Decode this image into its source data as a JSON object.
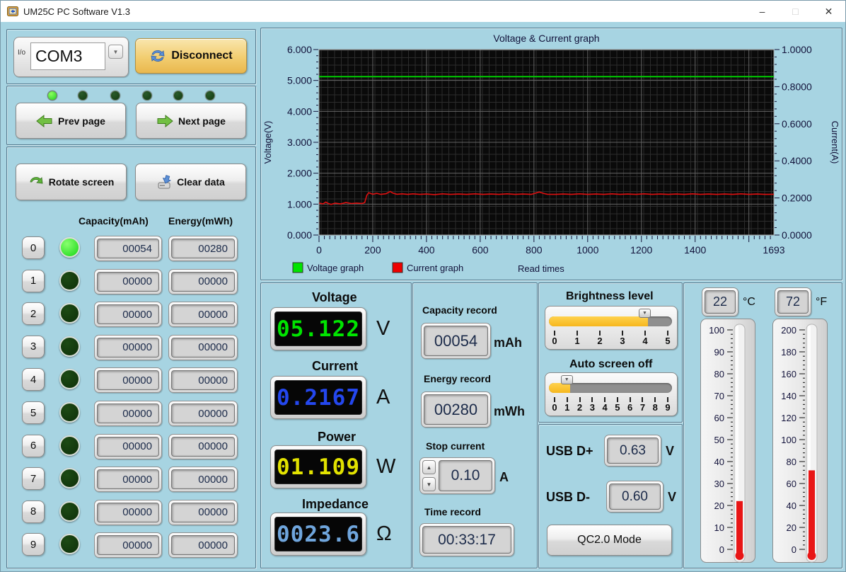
{
  "window": {
    "title": "UM25C PC Software V1.3",
    "minimize": "–",
    "maximize": "□",
    "close": "✕"
  },
  "connection": {
    "port": "COM3",
    "io_icon": "I/o",
    "dropdown_glyph": "▼",
    "disconnect_label": "Disconnect"
  },
  "page_nav": {
    "leds": [
      true,
      false,
      false,
      false,
      false,
      false
    ],
    "prev_label": "Prev page",
    "next_label": "Next page"
  },
  "actions": {
    "rotate_label": "Rotate screen",
    "clear_label": "Clear data"
  },
  "memory_table": {
    "capacity_header": "Capacity(mAh)",
    "energy_header": "Energy(mWh)",
    "rows": [
      {
        "index": "0",
        "active": true,
        "capacity": "00054",
        "energy": "00280"
      },
      {
        "index": "1",
        "active": false,
        "capacity": "00000",
        "energy": "00000"
      },
      {
        "index": "2",
        "active": false,
        "capacity": "00000",
        "energy": "00000"
      },
      {
        "index": "3",
        "active": false,
        "capacity": "00000",
        "energy": "00000"
      },
      {
        "index": "4",
        "active": false,
        "capacity": "00000",
        "energy": "00000"
      },
      {
        "index": "5",
        "active": false,
        "capacity": "00000",
        "energy": "00000"
      },
      {
        "index": "6",
        "active": false,
        "capacity": "00000",
        "energy": "00000"
      },
      {
        "index": "7",
        "active": false,
        "capacity": "00000",
        "energy": "00000"
      },
      {
        "index": "8",
        "active": false,
        "capacity": "00000",
        "energy": "00000"
      },
      {
        "index": "9",
        "active": false,
        "capacity": "00000",
        "energy": "00000"
      }
    ]
  },
  "chart_data": {
    "type": "line",
    "title": "Voltage & Current graph",
    "xlabel": "Read times",
    "ylabel_left": "Voltage(V)",
    "ylabel_right": "Current(A)",
    "xlim": [
      0,
      1693
    ],
    "x_ticks": [
      0,
      200,
      400,
      600,
      800,
      1000,
      1200,
      1400,
      1693
    ],
    "ylim_left": [
      0,
      6
    ],
    "y_ticks_left": [
      "6.000",
      "5.000",
      "4.000",
      "3.000",
      "2.000",
      "1.000",
      "0.000"
    ],
    "ylim_right": [
      0,
      1
    ],
    "y_ticks_right": [
      "1.0000",
      "0.8000",
      "0.6000",
      "0.4000",
      "0.2000",
      "0.0000"
    ],
    "legend": [
      {
        "label": "Voltage graph",
        "color": "#00e400"
      },
      {
        "label": "Current graph",
        "color": "#ee0000"
      }
    ],
    "series": [
      {
        "name": "Voltage",
        "axis": "left",
        "color": "#00cc00",
        "points": [
          [
            0,
            5.122
          ],
          [
            1693,
            5.122
          ]
        ]
      },
      {
        "name": "Current",
        "axis": "right",
        "color": "#e01010",
        "points": [
          [
            0,
            0.172
          ],
          [
            15,
            0.168
          ],
          [
            25,
            0.178
          ],
          [
            35,
            0.17
          ],
          [
            45,
            0.165
          ],
          [
            60,
            0.172
          ],
          [
            80,
            0.168
          ],
          [
            100,
            0.175
          ],
          [
            120,
            0.17
          ],
          [
            140,
            0.172
          ],
          [
            160,
            0.17
          ],
          [
            170,
            0.175
          ],
          [
            178,
            0.215
          ],
          [
            185,
            0.228
          ],
          [
            200,
            0.22
          ],
          [
            215,
            0.225
          ],
          [
            230,
            0.219
          ],
          [
            250,
            0.223
          ],
          [
            265,
            0.235
          ],
          [
            275,
            0.226
          ],
          [
            290,
            0.22
          ],
          [
            310,
            0.222
          ],
          [
            330,
            0.219
          ],
          [
            350,
            0.222
          ],
          [
            375,
            0.219
          ],
          [
            400,
            0.221
          ],
          [
            430,
            0.218
          ],
          [
            460,
            0.222
          ],
          [
            490,
            0.219
          ],
          [
            520,
            0.221
          ],
          [
            550,
            0.219
          ],
          [
            580,
            0.222
          ],
          [
            610,
            0.219
          ],
          [
            640,
            0.221
          ],
          [
            670,
            0.219
          ],
          [
            700,
            0.222
          ],
          [
            730,
            0.219
          ],
          [
            760,
            0.221
          ],
          [
            790,
            0.219
          ],
          [
            820,
            0.232
          ],
          [
            835,
            0.225
          ],
          [
            850,
            0.22
          ],
          [
            880,
            0.219
          ],
          [
            910,
            0.221
          ],
          [
            940,
            0.219
          ],
          [
            970,
            0.222
          ],
          [
            1000,
            0.219
          ],
          [
            1030,
            0.221
          ],
          [
            1060,
            0.219
          ],
          [
            1090,
            0.222
          ],
          [
            1120,
            0.219
          ],
          [
            1150,
            0.221
          ],
          [
            1180,
            0.219
          ],
          [
            1210,
            0.222
          ],
          [
            1240,
            0.219
          ],
          [
            1270,
            0.221
          ],
          [
            1300,
            0.219
          ],
          [
            1330,
            0.221
          ],
          [
            1360,
            0.219
          ],
          [
            1390,
            0.222
          ],
          [
            1420,
            0.219
          ],
          [
            1450,
            0.221
          ],
          [
            1480,
            0.219
          ],
          [
            1510,
            0.221
          ],
          [
            1540,
            0.219
          ],
          [
            1570,
            0.222
          ],
          [
            1600,
            0.219
          ],
          [
            1630,
            0.221
          ],
          [
            1660,
            0.219
          ],
          [
            1693,
            0.22
          ]
        ]
      }
    ]
  },
  "meters": {
    "voltage": {
      "label": "Voltage",
      "value": "05.122",
      "unit": "V",
      "color": "#00e400"
    },
    "current": {
      "label": "Current",
      "value": "0.2167",
      "unit": "A",
      "color": "#2447ee"
    },
    "power": {
      "label": "Power",
      "value": "01.109",
      "unit": "W",
      "color": "#e2e200"
    },
    "impedance": {
      "label": "Impedance",
      "value": "0023.6",
      "unit": "Ω",
      "color": "#6fa5dc"
    }
  },
  "records": {
    "capacity": {
      "label": "Capacity record",
      "value": "00054",
      "unit": "mAh"
    },
    "energy": {
      "label": "Energy record",
      "value": "00280",
      "unit": "mWh"
    },
    "stop_current": {
      "label": "Stop current",
      "value": "0.10",
      "unit": "A",
      "up_glyph": "▲",
      "down_glyph": "▼"
    },
    "time": {
      "label": "Time record",
      "value": "00:33:17"
    }
  },
  "device_settings": {
    "thumb_glyph": "▼",
    "brightness": {
      "label": "Brightness level",
      "min": 0,
      "max": 5,
      "value": 4,
      "ticks": [
        "0",
        "1",
        "2",
        "3",
        "4",
        "5"
      ]
    },
    "auto_screen_off": {
      "label": "Auto screen off",
      "min": 0,
      "max": 9,
      "value": 1,
      "ticks": [
        "0",
        "1",
        "2",
        "3",
        "4",
        "5",
        "6",
        "7",
        "8",
        "9"
      ]
    }
  },
  "usb": {
    "dplus": {
      "label": "USB D+",
      "value": "0.63",
      "unit": "V"
    },
    "dminus": {
      "label": "USB D-",
      "value": "0.60",
      "unit": "V"
    },
    "mode_label": "QC2.0 Mode"
  },
  "temperature": {
    "celsius": {
      "value": "22",
      "unit": "°C",
      "min": 0,
      "max": 100,
      "label_step": 10,
      "fill_color": "#e81616"
    },
    "fahrenheit": {
      "value": "72",
      "unit": "°F",
      "min": 0,
      "max": 200,
      "label_step": 20,
      "fill_color": "#e81616"
    }
  }
}
